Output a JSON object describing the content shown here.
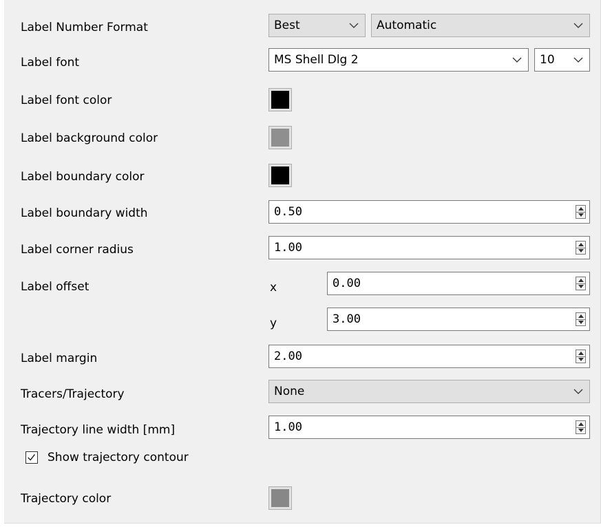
{
  "rows": {
    "number_format": {
      "label": "Label Number Format",
      "format_value": "Best",
      "mode_value": "Automatic"
    },
    "font": {
      "label": "Label font",
      "value": "MS Shell Dlg 2",
      "size": "10"
    },
    "font_color": {
      "label": "Label font color",
      "color": "#000000"
    },
    "background_color": {
      "label": "Label background color",
      "color": "#8f8f8f"
    },
    "boundary_color": {
      "label": "Label boundary color",
      "color": "#000000"
    },
    "boundary_width": {
      "label": "Label boundary width",
      "value": "0.50"
    },
    "corner_radius": {
      "label": "Label corner radius",
      "value": "1.00"
    },
    "offset": {
      "label": "Label offset",
      "x_label": "x",
      "x_value": "0.00",
      "y_label": "y",
      "y_value": "3.00"
    },
    "margin": {
      "label": "Label margin",
      "value": "2.00"
    },
    "tracers": {
      "label": "Tracers/Trajectory",
      "value": "None"
    },
    "trajectory_width": {
      "label": "Trajectory line width [mm]",
      "value": "1.00"
    },
    "show_contour": {
      "label": "Show trajectory contour",
      "checked": true
    },
    "trajectory_color": {
      "label": "Trajectory color",
      "color": "#878787"
    }
  },
  "icons": {
    "dropdown": "chevron-down-icon",
    "spinner": "spinbox-arrows-icon",
    "checkbox": "checkmark-icon"
  }
}
